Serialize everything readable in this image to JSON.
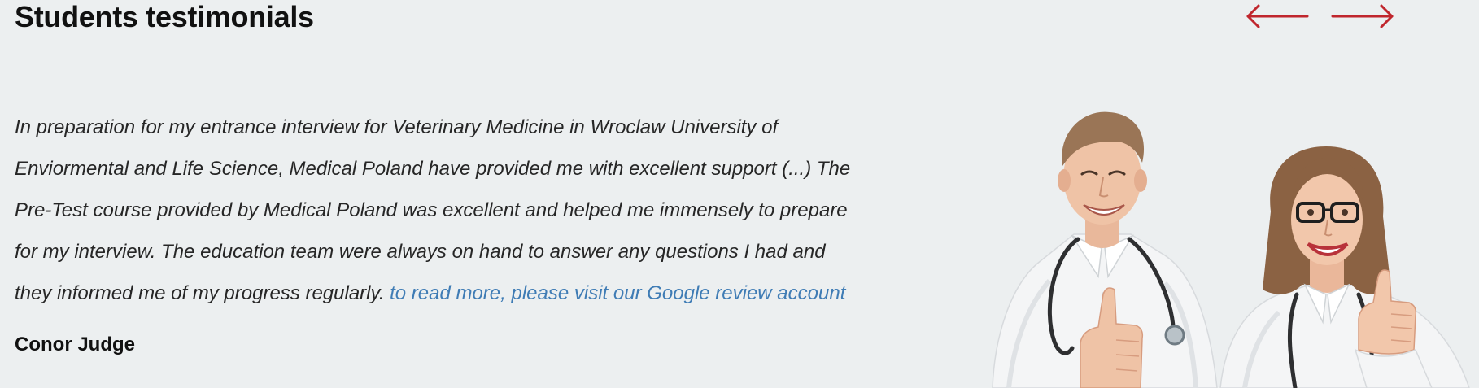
{
  "section": {
    "title": "Students testimonials"
  },
  "navigation": {
    "prev_icon": "arrow-left-icon",
    "next_icon": "arrow-right-icon",
    "arrow_color": "#c0262d"
  },
  "testimonial": {
    "text": "In preparation for my entrance interview for Veterinary Medicine in Wroclaw University of Enviormental and Life Science, Medical Poland have provided me with excellent support (...) The Pre-Test course provided by Medical Poland was excellent and helped me immensely to prepare for my interview. The education team were always on hand to answer any questions I had and they informed me of my progress regularly.",
    "link_text": "to read more, please visit our Google review account",
    "author": "Conor Judge",
    "link_color": "#3f7cb5"
  },
  "image": {
    "subject": "two-doctors-thumbs-up-photo"
  }
}
